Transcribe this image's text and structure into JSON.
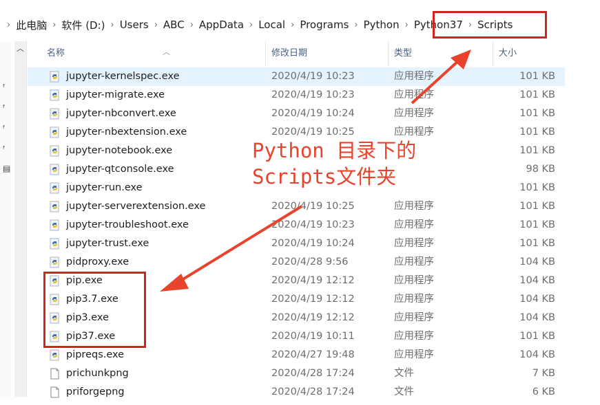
{
  "breadcrumb": [
    {
      "label": "此电脑"
    },
    {
      "label": "软件 (D:)"
    },
    {
      "label": "Users"
    },
    {
      "label": "ABC"
    },
    {
      "label": "AppData"
    },
    {
      "label": "Local"
    },
    {
      "label": "Programs"
    },
    {
      "label": "Python"
    },
    {
      "label": "Python37"
    },
    {
      "label": "Scripts"
    }
  ],
  "columns": {
    "name": "名称",
    "date": "修改日期",
    "type": "类型",
    "size": "大小"
  },
  "files": [
    {
      "name": "jupyter-kernelspec.exe",
      "date": "2020/4/19 10:23",
      "type": "应用程序",
      "size": "101 KB",
      "icon": "python-exe-icon",
      "selected": true
    },
    {
      "name": "jupyter-migrate.exe",
      "date": "2020/4/19 10:23",
      "type": "应用程序",
      "size": "101 KB",
      "icon": "python-exe-icon"
    },
    {
      "name": "jupyter-nbconvert.exe",
      "date": "2020/4/19 10:24",
      "type": "应用程序",
      "size": "101 KB",
      "icon": "python-exe-icon"
    },
    {
      "name": "jupyter-nbextension.exe",
      "date": "2020/4/19 10:25",
      "type": "应用程序",
      "size": "101 KB",
      "icon": "python-exe-icon"
    },
    {
      "name": "jupyter-notebook.exe",
      "date": "",
      "type": "",
      "size": "101 KB",
      "icon": "python-exe-icon"
    },
    {
      "name": "jupyter-qtconsole.exe",
      "date": "",
      "type": "",
      "size": "98 KB",
      "icon": "python-exe-icon"
    },
    {
      "name": "jupyter-run.exe",
      "date": "",
      "type": "",
      "size": "101 KB",
      "icon": "python-exe-icon"
    },
    {
      "name": "jupyter-serverextension.exe",
      "date": "2020/4/19 10:25",
      "type": "应用程序",
      "size": "101 KB",
      "icon": "python-exe-icon"
    },
    {
      "name": "jupyter-troubleshoot.exe",
      "date": "2020/4/19 10:23",
      "type": "应用程序",
      "size": "101 KB",
      "icon": "python-exe-icon"
    },
    {
      "name": "jupyter-trust.exe",
      "date": "2020/4/19 10:24",
      "type": "应用程序",
      "size": "101 KB",
      "icon": "python-exe-icon"
    },
    {
      "name": "pidproxy.exe",
      "date": "2020/4/28 9:56",
      "type": "应用程序",
      "size": "104 KB",
      "icon": "python-exe-icon"
    },
    {
      "name": "pip.exe",
      "date": "2020/4/19 12:12",
      "type": "应用程序",
      "size": "104 KB",
      "icon": "python-exe-icon"
    },
    {
      "name": "pip3.7.exe",
      "date": "2020/4/19 12:12",
      "type": "应用程序",
      "size": "104 KB",
      "icon": "python-exe-icon"
    },
    {
      "name": "pip3.exe",
      "date": "2020/4/19 12:12",
      "type": "应用程序",
      "size": "104 KB",
      "icon": "python-exe-icon"
    },
    {
      "name": "pip37.exe",
      "date": "2020/4/19 10:11",
      "type": "应用程序",
      "size": "101 KB",
      "icon": "python-exe-icon"
    },
    {
      "name": "pipreqs.exe",
      "date": "2020/4/27 19:48",
      "type": "应用程序",
      "size": "104 KB",
      "icon": "python-exe-icon"
    },
    {
      "name": "prichunkpng",
      "date": "2020/4/28 17:24",
      "type": "文件",
      "size": "7 KB",
      "icon": "blank-file-icon"
    },
    {
      "name": "priforgepng",
      "date": "2020/4/28 17:24",
      "type": "文件",
      "size": "6 KB",
      "icon": "blank-file-icon"
    }
  ],
  "annotation": {
    "line1": "Python 目录下的",
    "line2": "Scripts文件夹",
    "color": "#e8432c"
  },
  "colors": {
    "selected_row": "#e5f3ff",
    "header_text": "#4d6082",
    "highlight_box": "#d0241f"
  }
}
